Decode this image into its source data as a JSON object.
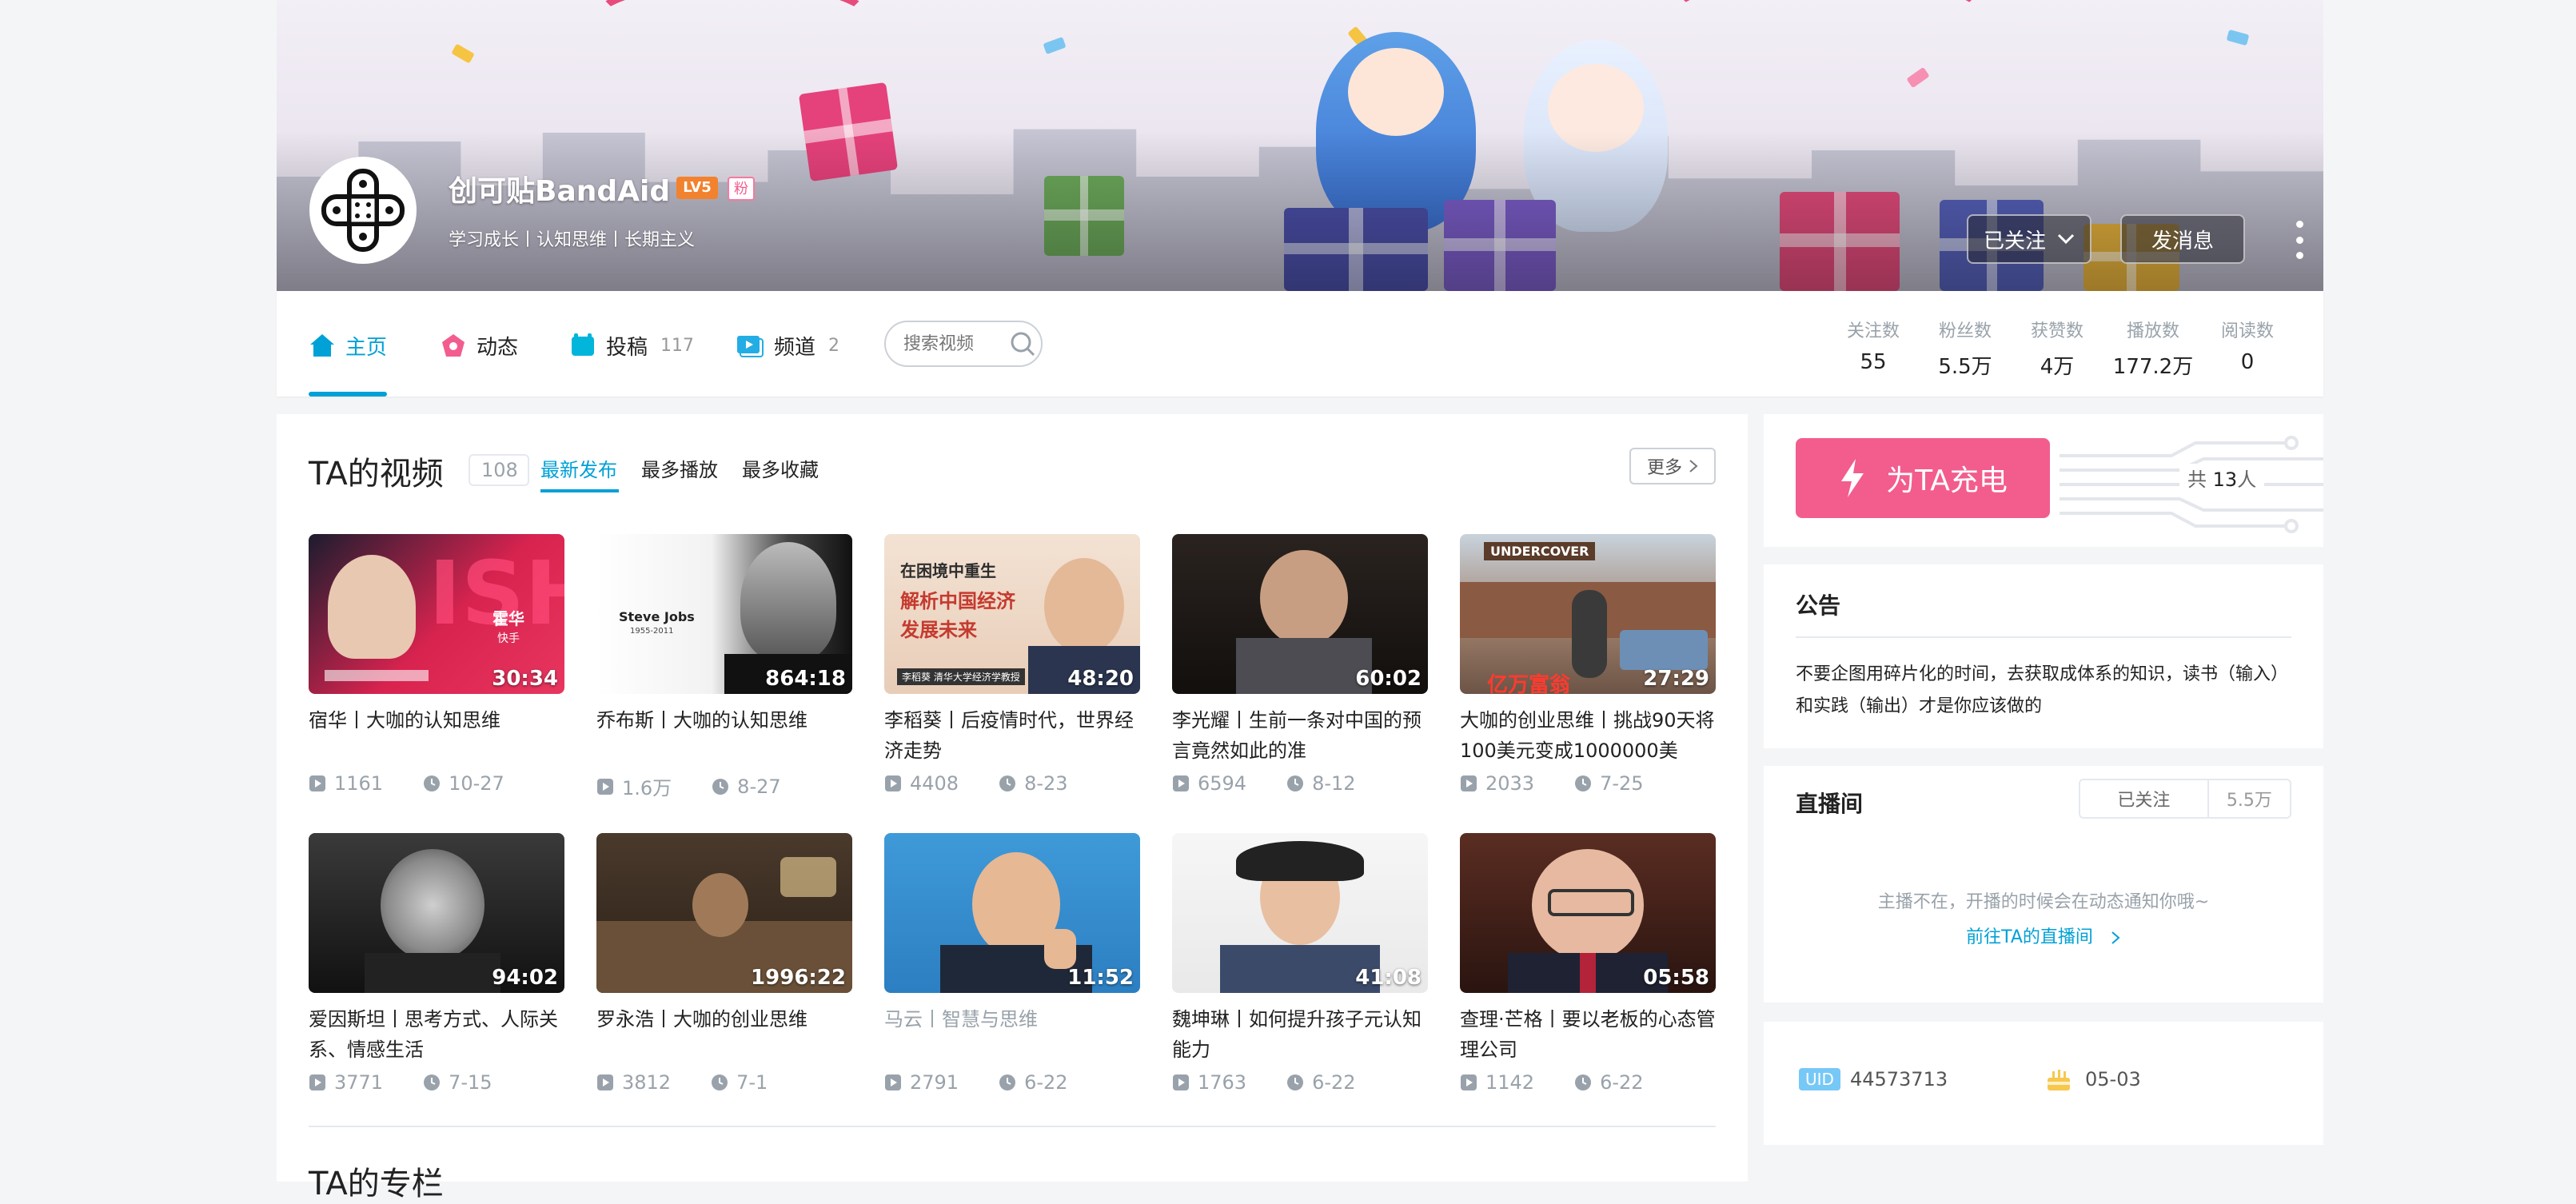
{
  "profile": {
    "name": "创可贴BandAid",
    "level": "LV5",
    "fan_badge": "粉",
    "sign": "学习成长丨认知思维丨长期主义",
    "follow_label": "已关注",
    "message_label": "发消息"
  },
  "nav": {
    "tabs": [
      {
        "label": "主页",
        "count": ""
      },
      {
        "label": "动态",
        "count": ""
      },
      {
        "label": "投稿",
        "count": "117"
      },
      {
        "label": "频道",
        "count": "2"
      }
    ],
    "search_placeholder": "搜索视频",
    "stats": [
      {
        "label": "关注数",
        "value": "55"
      },
      {
        "label": "粉丝数",
        "value": "5.5万"
      },
      {
        "label": "获赞数",
        "value": "4万"
      },
      {
        "label": "播放数",
        "value": "177.2万"
      },
      {
        "label": "阅读数",
        "value": "0"
      }
    ]
  },
  "videos_section": {
    "title": "TA的视频",
    "count": "108",
    "sorts": [
      "最新发布",
      "最多播放",
      "最多收藏"
    ],
    "more_label": "更多",
    "items": [
      {
        "duration": "30:34",
        "title": "宿华丨大咖的认知思维",
        "plays": "1161",
        "date": "10-27"
      },
      {
        "duration": "864:18",
        "title": "乔布斯丨大咖的认知思维",
        "plays": "1.6万",
        "date": "8-27"
      },
      {
        "duration": "48:20",
        "title": "李稻葵丨后疫情时代，世界经济走势",
        "plays": "4408",
        "date": "8-23"
      },
      {
        "duration": "60:02",
        "title": "李光耀丨生前一条对中国的预言竟然如此的准",
        "plays": "6594",
        "date": "8-12"
      },
      {
        "duration": "27:29",
        "title": "大咖的创业思维丨挑战90天将100美元变成1000000美",
        "plays": "2033",
        "date": "7-25"
      },
      {
        "duration": "94:02",
        "title": "爱因斯坦丨思考方式、人际关系、情感生活",
        "plays": "3771",
        "date": "7-15"
      },
      {
        "duration": "1996:22",
        "title": "罗永浩丨大咖的创业思维",
        "plays": "3812",
        "date": "7-1"
      },
      {
        "duration": "11:52",
        "title": "马云丨智慧与思维",
        "plays": "2791",
        "date": "6-22"
      },
      {
        "duration": "41:08",
        "title": "魏坤琳丨如何提升孩子元认知能力",
        "plays": "1763",
        "date": "6-22"
      },
      {
        "duration": "05:58",
        "title": "查理·芒格丨要以老板的心态管理公司",
        "plays": "1142",
        "date": "6-22"
      }
    ],
    "thumb_texts": {
      "t1_line1": "霍华",
      "t1_line2": "快手",
      "t2": "Steve Jobs",
      "t2_years": "1955-2011",
      "t3_line1": "在困境中重生",
      "t3_line2": "解析中国经济",
      "t3_line3": "发展未来",
      "t3_caption": "李稻葵  清华大学经济学教授",
      "t5_top": "UNDERCOVER",
      "t5_bottom": "亿万富翁"
    },
    "next_title": "TA的专栏"
  },
  "charge": {
    "button_label": "为TA充电",
    "total_prefix": "共",
    "total_value": "13",
    "total_suffix": "人"
  },
  "notice": {
    "title": "公告",
    "text": "不要企图用碎片化的时间，去获取成体系的知识，读书（输入）和实践（输出）才是你应该做的"
  },
  "live": {
    "title": "直播间",
    "follow_label": "已关注",
    "follow_count": "5.5万",
    "tip": "主播不在，开播的时候会在动态通知你哦~",
    "link": "前往TA的直播间"
  },
  "info": {
    "uid_label": "UID",
    "uid": "44573713",
    "birthday": "05-03"
  },
  "colors": {
    "accent": "#00a1d6",
    "pink": "#f25d8e",
    "level": "#f2822d"
  }
}
